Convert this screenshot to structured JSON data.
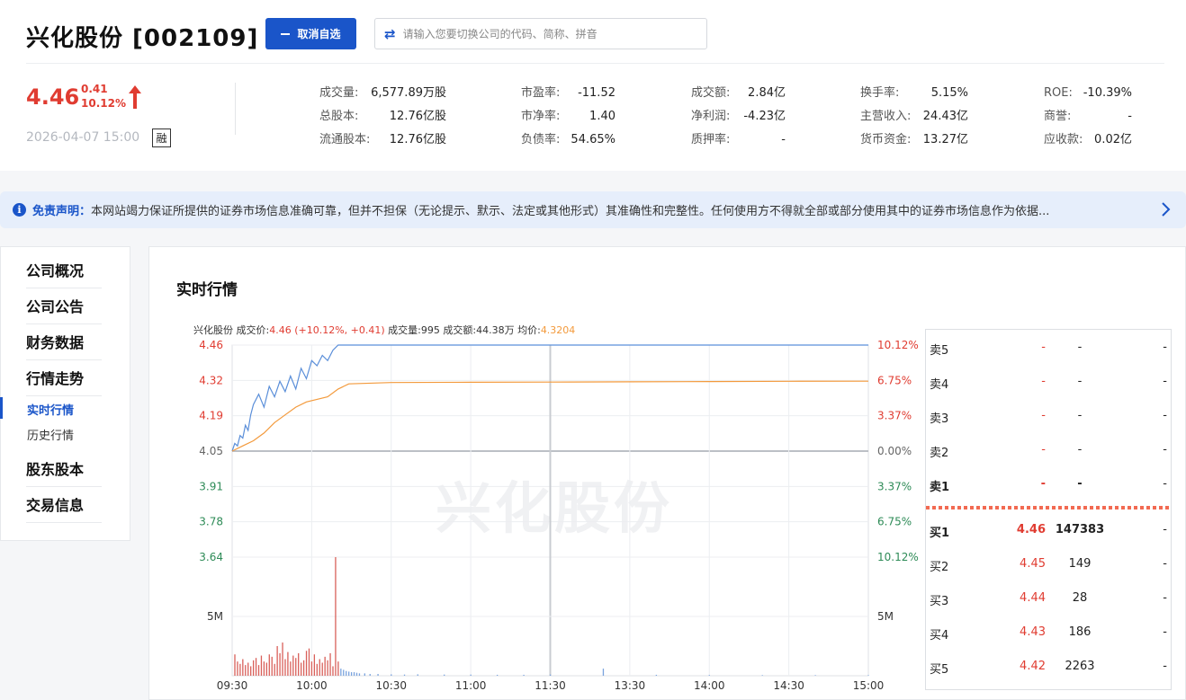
{
  "header": {
    "stock_name": "兴化股份 [002109]",
    "unfollow_label": "取消自选",
    "search_placeholder": "请输入您要切换公司的代码、简称、拼音",
    "price": "4.46",
    "change_abs": "0.41",
    "change_pct": "10.12%",
    "datetime": "2026-04-07 15:00",
    "badge": "融"
  },
  "metrics": [
    {
      "label": "成交量:",
      "value": "6,577.89万股"
    },
    {
      "label": "总股本:",
      "value": "12.76亿股"
    },
    {
      "label": "流通股本:",
      "value": "12.76亿股"
    },
    {
      "label": "市盈率:",
      "value": "-11.52"
    },
    {
      "label": "市净率:",
      "value": "1.40"
    },
    {
      "label": "负债率:",
      "value": "54.65%"
    },
    {
      "label": "成交额:",
      "value": "2.84亿"
    },
    {
      "label": "净利润:",
      "value": "-4.23亿"
    },
    {
      "label": "质押率:",
      "value": "-"
    },
    {
      "label": "换手率:",
      "value": "5.15%"
    },
    {
      "label": "主营收入:",
      "value": "24.43亿"
    },
    {
      "label": "货币资金:",
      "value": "13.27亿"
    },
    {
      "label": "ROE:",
      "value": "-10.39%"
    },
    {
      "label": "商誉:",
      "value": "-"
    },
    {
      "label": "应收款:",
      "value": "0.02亿"
    }
  ],
  "disclaimer": {
    "title": "免责声明：",
    "text": "本网站竭力保证所提供的证券市场信息准确可靠，但并不担保（无论提示、默示、法定或其他形式）其准确性和完整性。任何使用方不得就全部或部分使用其中的证券市场信息作为依据..."
  },
  "nav": {
    "items": [
      "公司概况",
      "公司公告",
      "财务数据",
      "行情走势",
      "股东股本",
      "交易信息"
    ],
    "sub_items": [
      "实时行情",
      "历史行情"
    ]
  },
  "panel": {
    "title": "实时行情",
    "watermark": "兴化股份"
  },
  "legend": {
    "name": "兴化股份",
    "price_label": "成交价:",
    "price_value": "4.46 (+10.12%, +0.41)",
    "vol_label": "成交量:",
    "vol_value": "995",
    "amount_label": "成交额:",
    "amount_value": "44.38万",
    "avg_label": "均价:",
    "avg_value": "4.3204"
  },
  "colors": {
    "up": "#e03c31",
    "down": "#2e8b57",
    "price_line": "#5b8fd9",
    "avg_line": "#f39a3c",
    "accent": "#1a55c9"
  },
  "chart_data": {
    "type": "line",
    "prev_close": 4.05,
    "y_ticks": [
      "4.46",
      "4.32",
      "4.19",
      "4.05",
      "3.91",
      "3.78",
      "3.64"
    ],
    "y_right_ticks": [
      "10.12%",
      "6.75%",
      "3.37%",
      "0.00%",
      "3.37%",
      "6.75%",
      "10.12%"
    ],
    "x_ticks": [
      "09:30",
      "10:00",
      "10:30",
      "11:00",
      "11:30",
      "13:30",
      "14:00",
      "14:30",
      "15:00"
    ],
    "volume_tick": "5M",
    "ylim": [
      3.64,
      4.46
    ],
    "series": [
      {
        "x": [
          0,
          1,
          2,
          3,
          4,
          5,
          6,
          7,
          8,
          10,
          12,
          14,
          16,
          18,
          20,
          22,
          24,
          26,
          28,
          30,
          32,
          34,
          36,
          38,
          40,
          240
        ],
        "values": [
          4.05,
          4.08,
          4.07,
          4.11,
          4.1,
          4.15,
          4.13,
          4.19,
          4.23,
          4.27,
          4.22,
          4.3,
          4.26,
          4.32,
          4.28,
          4.34,
          4.29,
          4.37,
          4.33,
          4.4,
          4.38,
          4.42,
          4.4,
          4.44,
          4.46,
          4.46
        ]
      },
      {
        "x": [
          0,
          4,
          8,
          12,
          16,
          20,
          24,
          28,
          32,
          36,
          40,
          44,
          60,
          90,
          120,
          150,
          180,
          210,
          240
        ],
        "values": [
          4.05,
          4.07,
          4.09,
          4.12,
          4.16,
          4.19,
          4.22,
          4.24,
          4.25,
          4.26,
          4.29,
          4.31,
          4.315,
          4.316,
          4.317,
          4.318,
          4.319,
          4.32,
          4.3204
        ]
      }
    ],
    "volume": {
      "x": [
        1,
        2,
        3,
        4,
        5,
        6,
        7,
        8,
        9,
        10,
        11,
        12,
        13,
        14,
        15,
        16,
        17,
        18,
        19,
        20,
        21,
        22,
        23,
        24,
        25,
        26,
        27,
        28,
        29,
        30,
        31,
        32,
        33,
        34,
        35,
        36,
        37,
        38,
        39,
        40,
        41,
        42,
        43,
        44,
        45,
        46,
        47,
        48,
        50,
        52,
        55,
        60,
        65,
        70,
        80,
        90,
        100,
        110,
        120,
        140,
        160,
        180,
        200,
        220,
        240
      ],
      "values": [
        1.8,
        1.2,
        1.0,
        1.4,
        0.9,
        1.1,
        0.8,
        1.3,
        1.5,
        0.9,
        1.7,
        1.2,
        1.1,
        1.8,
        1.6,
        1.0,
        2.5,
        1.9,
        2.8,
        1.4,
        2.0,
        1.2,
        1.7,
        1.5,
        1.9,
        1.1,
        1.3,
        2.1,
        2.3,
        1.2,
        1.8,
        1.0,
        1.4,
        1.1,
        1.6,
        1.3,
        1.9,
        0.8,
        10.0,
        1.2,
        0.6,
        0.5,
        0.4,
        0.35,
        0.3,
        0.3,
        0.25,
        0.2,
        0.2,
        0.15,
        0.15,
        0.12,
        0.1,
        0.12,
        0.1,
        0.1,
        0.08,
        0.08,
        0.1,
        0.6,
        0.08,
        0.06,
        0.05,
        0.05,
        0.05
      ]
    }
  },
  "orderbook": {
    "sell": [
      {
        "label": "卖5",
        "price": "-",
        "vol": "-",
        "ext": "-"
      },
      {
        "label": "卖4",
        "price": "-",
        "vol": "-",
        "ext": "-"
      },
      {
        "label": "卖3",
        "price": "-",
        "vol": "-",
        "ext": "-"
      },
      {
        "label": "卖2",
        "price": "-",
        "vol": "-",
        "ext": "-"
      },
      {
        "label": "卖1",
        "price": "-",
        "vol": "-",
        "ext": "-"
      }
    ],
    "buy": [
      {
        "label": "买1",
        "price": "4.46",
        "vol": "147383",
        "ext": "-"
      },
      {
        "label": "买2",
        "price": "4.45",
        "vol": "149",
        "ext": "-"
      },
      {
        "label": "买3",
        "price": "4.44",
        "vol": "28",
        "ext": "-"
      },
      {
        "label": "买4",
        "price": "4.43",
        "vol": "186",
        "ext": "-"
      },
      {
        "label": "买5",
        "price": "4.42",
        "vol": "2263",
        "ext": "-"
      }
    ]
  }
}
